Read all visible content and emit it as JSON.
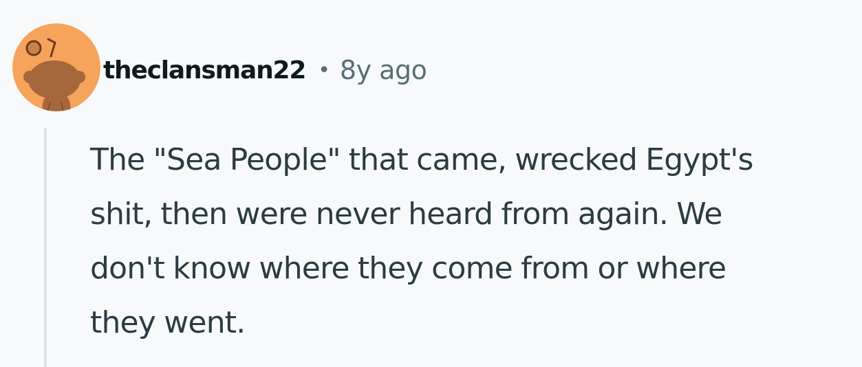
{
  "comment": {
    "author": "theclansman22",
    "separator": "•",
    "time_ago": "8y ago",
    "avatar_icon": "snoo-avatar-icon",
    "avatar_color": "#f6a35c",
    "body_lines": [
      "The \"Sea People\" that came, wrecked Egypt's",
      "shit, then were never heard from again. We",
      "don't know where they come from or where",
      "they went."
    ]
  }
}
